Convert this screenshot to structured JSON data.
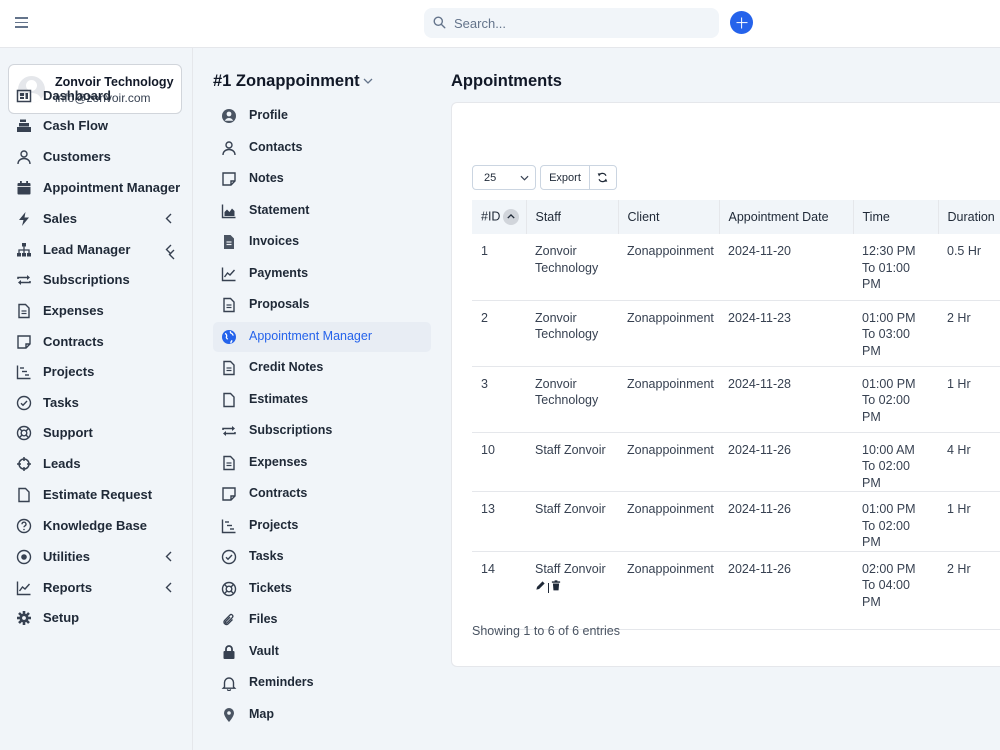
{
  "topbar": {
    "search_placeholder": "Search..."
  },
  "user": {
    "name": "Zonvoir Technology",
    "email": "info@zonvoir.com"
  },
  "sidebar": {
    "items": [
      {
        "label": "Dashboard",
        "icon": "dashboard-icon",
        "chevron": false
      },
      {
        "label": "Cash Flow",
        "icon": "cash-register-icon",
        "chevron": false
      },
      {
        "label": "Customers",
        "icon": "user-icon",
        "chevron": false
      },
      {
        "label": "Appointment Manager",
        "icon": "calendar-icon",
        "chevron": false
      },
      {
        "label": "Sales",
        "icon": "bolt-icon",
        "chevron": true
      },
      {
        "label": "Lead Manager",
        "icon": "sitemap-icon",
        "chevron": true
      },
      {
        "label": "Subscriptions",
        "icon": "repeat-icon",
        "chevron": false
      },
      {
        "label": "Expenses",
        "icon": "file-lines-icon",
        "chevron": false
      },
      {
        "label": "Contracts",
        "icon": "sticky-note-icon",
        "chevron": false
      },
      {
        "label": "Projects",
        "icon": "chart-steps-icon",
        "chevron": false
      },
      {
        "label": "Tasks",
        "icon": "check-circle-icon",
        "chevron": false
      },
      {
        "label": "Support",
        "icon": "lifebuoy-icon",
        "chevron": false
      },
      {
        "label": "Leads",
        "icon": "crosshair-icon",
        "chevron": false
      },
      {
        "label": "Estimate Request",
        "icon": "file-icon",
        "chevron": false
      },
      {
        "label": "Knowledge Base",
        "icon": "question-circle-icon",
        "chevron": false
      },
      {
        "label": "Utilities",
        "icon": "dot-circle-icon",
        "chevron": true
      },
      {
        "label": "Reports",
        "icon": "line-chart-icon",
        "chevron": true
      },
      {
        "label": "Setup",
        "icon": "gear-icon",
        "chevron": false
      }
    ]
  },
  "client_panel": {
    "title": "#1 Zonappoinment",
    "items": [
      {
        "label": "Profile",
        "icon": "user-circle-icon"
      },
      {
        "label": "Contacts",
        "icon": "user-icon"
      },
      {
        "label": "Notes",
        "icon": "sticky-note-icon"
      },
      {
        "label": "Statement",
        "icon": "area-chart-icon"
      },
      {
        "label": "Invoices",
        "icon": "file-solid-icon"
      },
      {
        "label": "Payments",
        "icon": "line-chart-icon"
      },
      {
        "label": "Proposals",
        "icon": "file-lines-icon"
      },
      {
        "label": "Appointment Manager",
        "icon": "globe-icon",
        "active": true
      },
      {
        "label": "Credit Notes",
        "icon": "file-lines-icon"
      },
      {
        "label": "Estimates",
        "icon": "file-icon"
      },
      {
        "label": "Subscriptions",
        "icon": "repeat-icon"
      },
      {
        "label": "Expenses",
        "icon": "file-lines-icon"
      },
      {
        "label": "Contracts",
        "icon": "sticky-note-icon"
      },
      {
        "label": "Projects",
        "icon": "chart-steps-icon"
      },
      {
        "label": "Tasks",
        "icon": "check-circle-icon"
      },
      {
        "label": "Tickets",
        "icon": "lifebuoy-icon"
      },
      {
        "label": "Files",
        "icon": "paperclip-icon"
      },
      {
        "label": "Vault",
        "icon": "lock-icon"
      },
      {
        "label": "Reminders",
        "icon": "bell-icon"
      },
      {
        "label": "Map",
        "icon": "map-marker-icon"
      }
    ]
  },
  "main": {
    "title": "Appointments",
    "page_length": "25",
    "export_label": "Export",
    "columns": [
      "#ID",
      "Staff",
      "Client",
      "Appointment Date",
      "Time",
      "Duration"
    ],
    "rows": [
      {
        "id": "1",
        "staff": "Zonvoir Technology",
        "client": "Zonappoinment",
        "date": "2024-11-20",
        "time": "12:30 PM To 01:00 PM",
        "duration": "0.5 Hr"
      },
      {
        "id": "2",
        "staff": "Zonvoir Technology",
        "client": "Zonappoinment",
        "date": "2024-11-23",
        "time": "01:00 PM To 03:00 PM",
        "duration": "2 Hr"
      },
      {
        "id": "3",
        "staff": "Zonvoir Technology",
        "client": "Zonappoinment",
        "date": "2024-11-28",
        "time": "01:00 PM To 02:00 PM",
        "duration": "1 Hr"
      },
      {
        "id": "10",
        "staff": "Staff Zonvoir",
        "client": "Zonappoinment",
        "date": "2024-11-26",
        "time": "10:00 AM To 02:00 PM",
        "duration": "4 Hr"
      },
      {
        "id": "13",
        "staff": "Staff Zonvoir",
        "client": "Zonappoinment",
        "date": "2024-11-26",
        "time": "01:00 PM To 02:00 PM",
        "duration": "1 Hr"
      },
      {
        "id": "14",
        "staff": "Staff Zonvoir",
        "client": "Zonappoinment",
        "date": "2024-11-26",
        "time": "02:00 PM To 04:00 PM",
        "duration": "2 Hr",
        "show_actions": true
      }
    ],
    "footer_info": "Showing 1 to 6 of 6 entries"
  }
}
